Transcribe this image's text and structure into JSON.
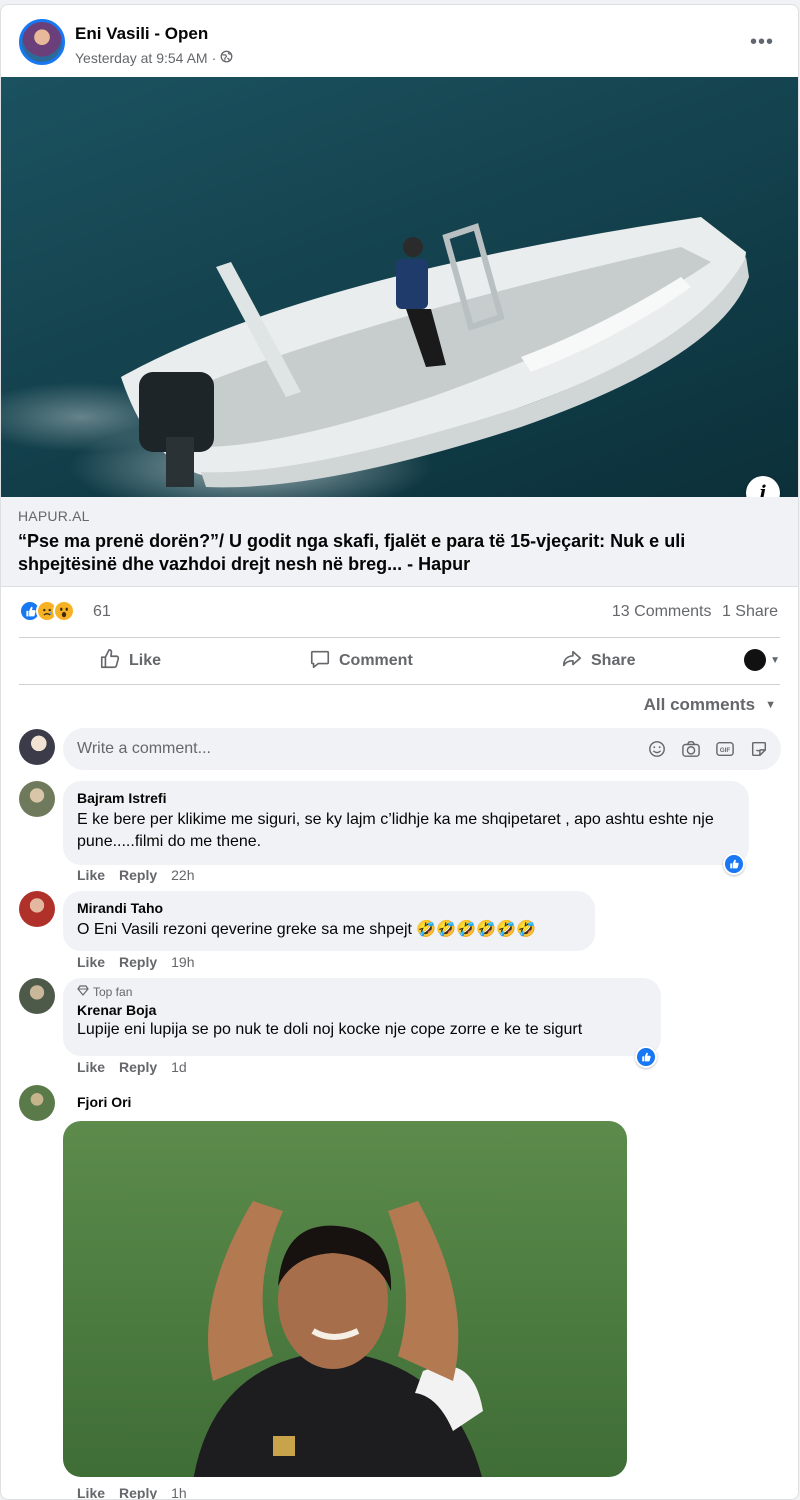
{
  "post": {
    "author": "Eni Vasili - Open",
    "timestamp": "Yesterday at 9:54 AM",
    "separator": "·",
    "more_label": "•••"
  },
  "link": {
    "domain": "HAPUR.AL",
    "title": "“Pse ma prenë dorën?”/ U godit nga skafi, fjalët e para të 15-vjeçarit: Nuk e uli shpejtësinë dhe vazhdoi drejt nesh në breg... - Hapur",
    "info_label": "i"
  },
  "stats": {
    "reactions": [
      "like",
      "sad",
      "wow"
    ],
    "reaction_count": "61",
    "comments": "13 Comments",
    "shares": "1 Share"
  },
  "actions": {
    "like": "Like",
    "comment": "Comment",
    "share": "Share"
  },
  "filter": {
    "label": "All comments"
  },
  "composer": {
    "placeholder": "Write a comment...",
    "icons": [
      "emoji-icon",
      "camera-icon",
      "gif-icon",
      "sticker-icon"
    ]
  },
  "comments": [
    {
      "name": "Bajram Istrefi",
      "text": "E ke bere per klikime me siguri, se ky lajm c’lidhje ka me shqipetaret , apo ashtu eshte nje pune.....filmi do me thene.",
      "like": "Like",
      "reply": "Reply",
      "time": "22h",
      "reaction": "like"
    },
    {
      "name": "Mirandi Taho",
      "text": "O Eni Vasili rezoni qeverine greke sa me shpejt 🤣🤣🤣🤣🤣🤣",
      "like": "Like",
      "reply": "Reply",
      "time": "19h"
    },
    {
      "badge": "Top fan",
      "name": "Krenar Boja",
      "text": "Lupije eni lupija se po nuk te doli noj kocke nje cope zorre e ke te sigurt",
      "like": "Like",
      "reply": "Reply",
      "time": "1d",
      "reaction": "like"
    },
    {
      "name": "Fjori Ori",
      "attachment": "gif",
      "like": "Like",
      "reply": "Reply",
      "time": "1h"
    }
  ],
  "colors": {
    "accent": "#1877f2",
    "secondary_text": "#65676b",
    "bubble": "#f0f2f5"
  }
}
